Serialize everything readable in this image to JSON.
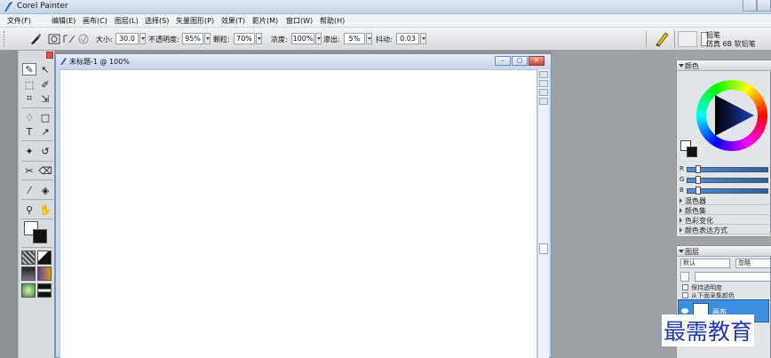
{
  "window": {
    "title": "Corel Painter"
  },
  "menu": [
    "文件(F)",
    "编辑(E)",
    "画布(C)",
    "图层(L)",
    "选择(S)",
    "矢量图形(P)",
    "效果(T)",
    "影片(M)",
    "窗口(W)",
    "帮助(H)"
  ],
  "propbar": {
    "size_label": "大小:",
    "size_value": "30.0",
    "opacity_label": "不透明度:",
    "opacity_value": "95%",
    "grain_label": "颗粒:",
    "grain_value": "70%",
    "density_label": "浓度:",
    "density_value": "100%",
    "bleed_label": "渗出:",
    "bleed_value": "5%",
    "jitter_label": "抖动:",
    "jitter_value": "0.03"
  },
  "brush_selector": {
    "category": "铅笔",
    "variant": "仿真 6B 软铅笔"
  },
  "document": {
    "title": "未标题-1 @ 100%"
  },
  "color_panel": {
    "title": "颜色",
    "rgb_labels": [
      "R",
      "G",
      "B"
    ],
    "sections": [
      "混色器",
      "颜色集",
      "色彩变化",
      "颜色表达方式"
    ]
  },
  "layers_panel": {
    "title": "图层",
    "composite_method": "默认",
    "composite_depth": "忽略",
    "preserve_transparency": "保持透明度",
    "pick_up_underlying": "从下面采集颜色",
    "layer_name": "画布"
  },
  "watermark": "最需教育",
  "colors": {
    "accent": "#3d8ee0",
    "watermark": "#1f3aa8",
    "titlebar": "#c8d7ea"
  }
}
